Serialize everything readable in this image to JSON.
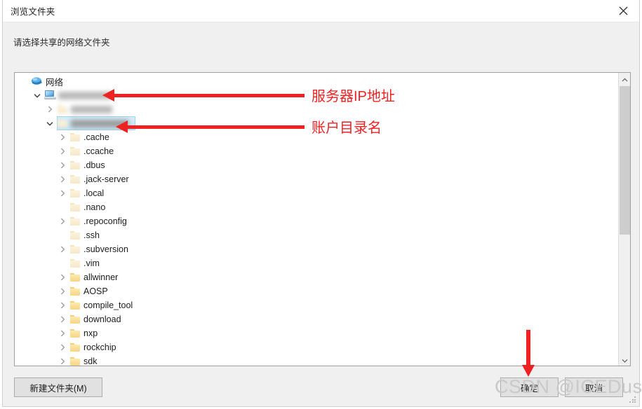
{
  "window": {
    "title": "浏览文件夹",
    "close_icon": "close-icon",
    "prompt": "请选择共享的网络文件夹"
  },
  "tree": {
    "root": {
      "label": "网络",
      "icon": "network-globe-icon"
    },
    "rows": [
      {
        "label": "网络",
        "icon": "network-globe-icon",
        "indent": 0,
        "chevron": "none",
        "redacted": false,
        "selected": false
      },
      {
        "label": "",
        "icon": "computer-icon",
        "indent": 1,
        "chevron": "expanded",
        "redacted": true,
        "redact_width": 76,
        "selected": false
      },
      {
        "label": "",
        "icon": "folder-pale",
        "indent": 2,
        "chevron": "collapsed",
        "redacted": true,
        "redact_width": 59,
        "selected": false
      },
      {
        "label": "",
        "icon": "folder-pale",
        "indent": 2,
        "chevron": "expanded",
        "redacted": true,
        "redact_width": 82,
        "selected": true
      },
      {
        "label": ".cache",
        "icon": "folder-pale",
        "indent": 3,
        "chevron": "collapsed",
        "redacted": false,
        "selected": false
      },
      {
        "label": ".ccache",
        "icon": "folder-pale",
        "indent": 3,
        "chevron": "collapsed",
        "redacted": false,
        "selected": false
      },
      {
        "label": ".dbus",
        "icon": "folder-pale",
        "indent": 3,
        "chevron": "collapsed",
        "redacted": false,
        "selected": false
      },
      {
        "label": ".jack-server",
        "icon": "folder-pale",
        "indent": 3,
        "chevron": "collapsed",
        "redacted": false,
        "selected": false
      },
      {
        "label": ".local",
        "icon": "folder-pale",
        "indent": 3,
        "chevron": "collapsed",
        "redacted": false,
        "selected": false
      },
      {
        "label": ".nano",
        "icon": "folder-pale",
        "indent": 3,
        "chevron": "none",
        "redacted": false,
        "selected": false
      },
      {
        "label": ".repoconfig",
        "icon": "folder-pale",
        "indent": 3,
        "chevron": "collapsed",
        "redacted": false,
        "selected": false
      },
      {
        "label": ".ssh",
        "icon": "folder-pale",
        "indent": 3,
        "chevron": "none",
        "redacted": false,
        "selected": false
      },
      {
        "label": ".subversion",
        "icon": "folder-pale",
        "indent": 3,
        "chevron": "collapsed",
        "redacted": false,
        "selected": false
      },
      {
        "label": ".vim",
        "icon": "folder-pale",
        "indent": 3,
        "chevron": "none",
        "redacted": false,
        "selected": false
      },
      {
        "label": "allwinner",
        "icon": "folder-normal",
        "indent": 3,
        "chevron": "collapsed",
        "redacted": false,
        "selected": false
      },
      {
        "label": "AOSP",
        "icon": "folder-normal",
        "indent": 3,
        "chevron": "collapsed",
        "redacted": false,
        "selected": false
      },
      {
        "label": "compile_tool",
        "icon": "folder-normal",
        "indent": 3,
        "chevron": "collapsed",
        "redacted": false,
        "selected": false
      },
      {
        "label": "download",
        "icon": "folder-normal",
        "indent": 3,
        "chevron": "collapsed",
        "redacted": false,
        "selected": false
      },
      {
        "label": "nxp",
        "icon": "folder-normal",
        "indent": 3,
        "chevron": "collapsed",
        "redacted": false,
        "selected": false
      },
      {
        "label": "rockchip",
        "icon": "folder-normal",
        "indent": 3,
        "chevron": "collapsed",
        "redacted": false,
        "selected": false
      },
      {
        "label": "sdk",
        "icon": "folder-normal",
        "indent": 3,
        "chevron": "collapsed",
        "redacted": false,
        "selected": false
      }
    ],
    "scrollbar": {
      "up_icon": "chevron-up-icon",
      "down_icon": "chevron-down-icon"
    }
  },
  "buttons": {
    "new_folder": "新建文件夹(M)",
    "ok": "确定",
    "cancel": "取消"
  },
  "annotations": {
    "server_ip": "服务器IP地址",
    "account_dir": "账户目录名"
  },
  "watermark": "CSDN @ICEDustpan",
  "colors": {
    "annotation_red": "#ee2222",
    "selection_blue": "#cce8f7",
    "dialog_gray": "#f0f0f0",
    "button_gray": "#e1e1e1"
  }
}
